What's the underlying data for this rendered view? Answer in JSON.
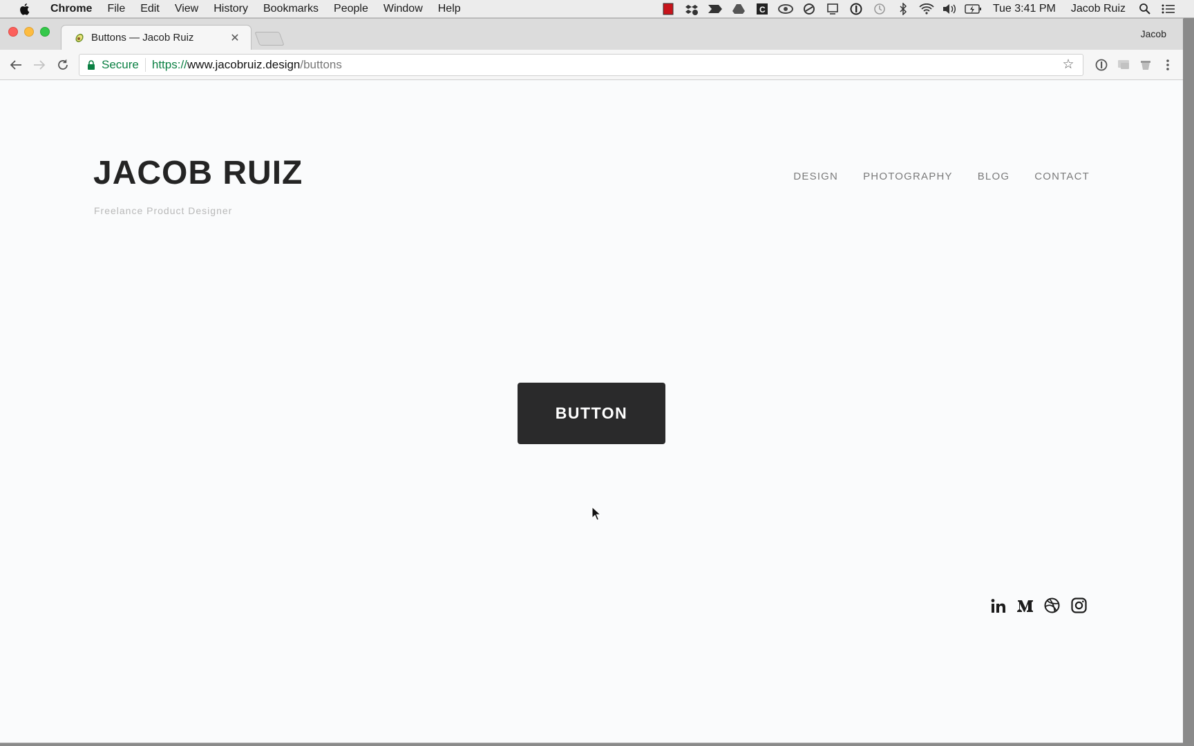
{
  "menubar": {
    "app": "Chrome",
    "items": [
      "File",
      "Edit",
      "View",
      "History",
      "Bookmarks",
      "People",
      "Window",
      "Help"
    ],
    "clock": "Tue 3:41 PM",
    "user": "Jacob Ruiz"
  },
  "browser": {
    "profile": "Jacob",
    "tab": {
      "title": "Buttons — Jacob Ruiz"
    },
    "omnibox": {
      "secure_label": "Secure",
      "scheme": "https://",
      "host": "www.jacobruiz.design",
      "path": "/buttons"
    }
  },
  "site": {
    "logo": "JACOB RUIZ",
    "tagline": "Freelance Product Designer",
    "nav": [
      "DESIGN",
      "PHOTOGRAPHY",
      "BLOG",
      "CONTACT"
    ],
    "button_label": "BUTTON",
    "social": [
      "linkedin-icon",
      "medium-icon",
      "dribbble-icon",
      "instagram-icon"
    ]
  },
  "colors": {
    "button_bg": "#2a2a2b",
    "secure_green": "#0b8043",
    "page_bg": "#fafbfc"
  }
}
